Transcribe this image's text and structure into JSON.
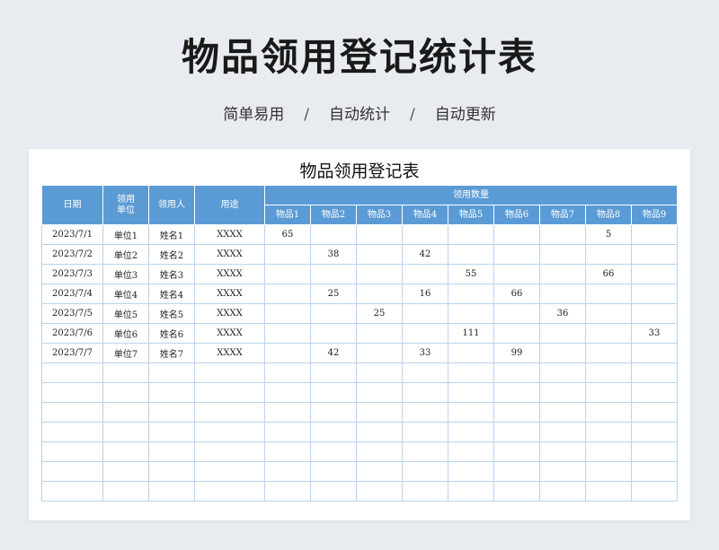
{
  "header": {
    "title": "物品领用登记统计表",
    "subtitle_items": [
      "简单易用",
      "自动统计",
      "自动更新"
    ],
    "separator": "/"
  },
  "sheet": {
    "title": "物品领用登记表",
    "columns": {
      "date": "日期",
      "unit": "领用\n单位",
      "person": "领用人",
      "use": "用途",
      "quantity_group": "领用数量",
      "items": [
        "物品1",
        "物品2",
        "物品3",
        "物品4",
        "物品5",
        "物品6",
        "物品7",
        "物品8",
        "物品9"
      ]
    },
    "rows": [
      {
        "date": "2023/7/1",
        "unit": "单位1",
        "person": "姓名1",
        "use": "XXXX",
        "qty": [
          "65",
          "",
          "",
          "",
          "",
          "",
          "",
          "5",
          ""
        ]
      },
      {
        "date": "2023/7/2",
        "unit": "单位2",
        "person": "姓名2",
        "use": "XXXX",
        "qty": [
          "",
          "38",
          "",
          "42",
          "",
          "",
          "",
          "",
          ""
        ]
      },
      {
        "date": "2023/7/3",
        "unit": "单位3",
        "person": "姓名3",
        "use": "XXXX",
        "qty": [
          "",
          "",
          "",
          "",
          "55",
          "",
          "",
          "66",
          ""
        ]
      },
      {
        "date": "2023/7/4",
        "unit": "单位4",
        "person": "姓名4",
        "use": "XXXX",
        "qty": [
          "",
          "25",
          "",
          "16",
          "",
          "66",
          "",
          "",
          ""
        ]
      },
      {
        "date": "2023/7/5",
        "unit": "单位5",
        "person": "姓名5",
        "use": "XXXX",
        "qty": [
          "",
          "",
          "25",
          "",
          "",
          "",
          "36",
          "",
          ""
        ]
      },
      {
        "date": "2023/7/6",
        "unit": "单位6",
        "person": "姓名6",
        "use": "XXXX",
        "qty": [
          "",
          "",
          "",
          "",
          "111",
          "",
          "",
          "",
          "33"
        ]
      },
      {
        "date": "2023/7/7",
        "unit": "单位7",
        "person": "姓名7",
        "use": "XXXX",
        "qty": [
          "",
          "42",
          "",
          "33",
          "",
          "99",
          "",
          "",
          ""
        ]
      }
    ],
    "empty_rows": 7
  },
  "colors": {
    "header_fill": "#5b9bd5",
    "grid_line": "#b9d3ef",
    "background": "#e8ecf1"
  }
}
